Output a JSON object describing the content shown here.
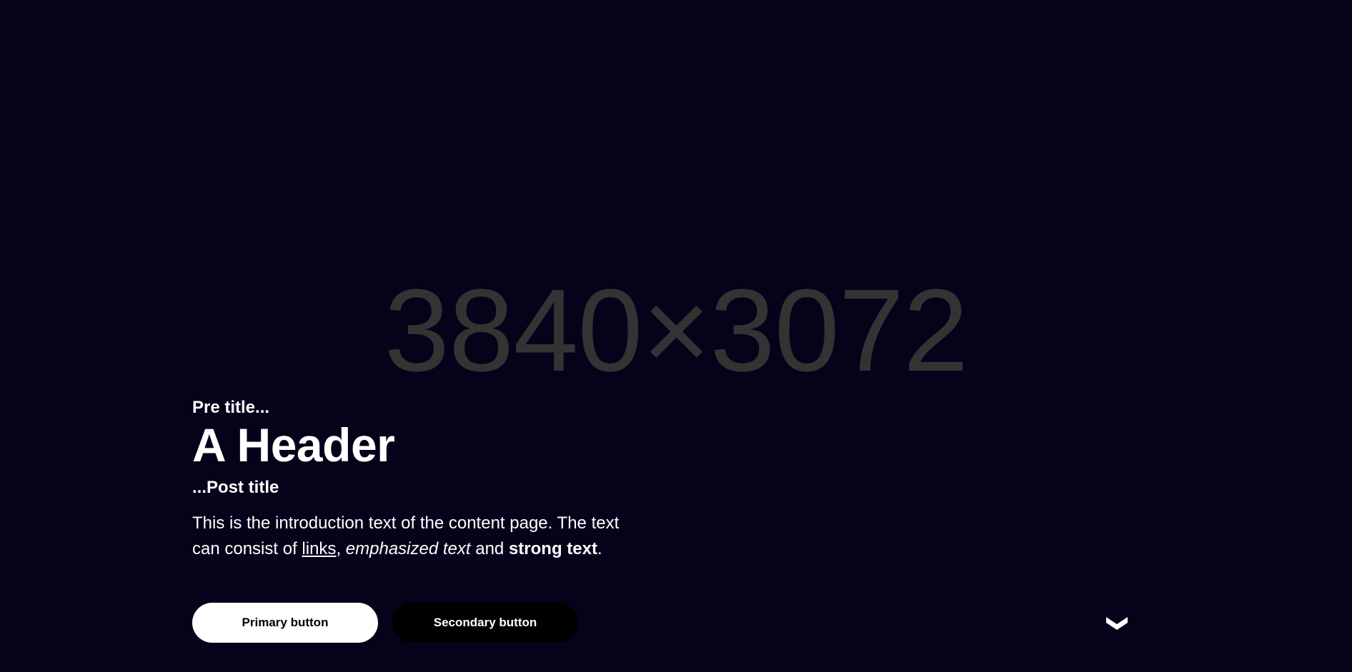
{
  "hero": {
    "placeholder_label": "3840×3072",
    "pre_title": "Pre title...",
    "header": "A Header",
    "post_title": "...Post title",
    "intro": {
      "line1": "This is the introduction text of the content page. The text can consist of ",
      "link_text": "links",
      "comma": ", ",
      "emphasized_text": "emphasized text",
      "and_text": " and ",
      "strong_text": "strong text",
      "period": "."
    },
    "primary_button_label": "Primary button",
    "secondary_button_label": "Secondary button",
    "scroll_icon": "chevron-down-icon"
  },
  "colors": {
    "background": "#05031a",
    "placeholder_text": "#333333",
    "text": "#ffffff",
    "primary_button_bg": "#ffffff",
    "secondary_button_bg": "#000000"
  }
}
